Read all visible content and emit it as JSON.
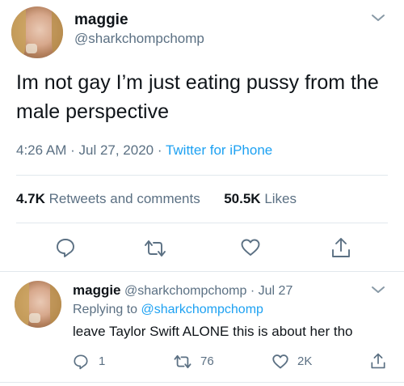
{
  "tweet": {
    "author_name": "maggie",
    "author_handle": "@sharkchompchomp",
    "text": "Im not gay I’m just eating pussy from the male perspective",
    "time": "4:26 AM",
    "date": "Jul 27, 2020",
    "source": "Twitter for iPhone",
    "retweets_count": "4.7K",
    "retweets_label": "Retweets and comments",
    "likes_count": "50.5K",
    "likes_label": "Likes"
  },
  "reply": {
    "author_name": "maggie",
    "author_handle": "@sharkchompchomp",
    "date": "Jul 27",
    "replying_to_prefix": "Replying to",
    "replying_to_handle": "@sharkchompchomp",
    "text": "leave Taylor Swift ALONE this is about her tho",
    "reply_count": "1",
    "retweet_count": "76",
    "like_count": "2K"
  },
  "icons": [
    "chevron-down-icon",
    "reply-icon",
    "retweet-icon",
    "like-icon",
    "share-icon"
  ],
  "colors": {
    "link": "#1da1f2",
    "secondary_text": "#5b7083",
    "divider": "#e1e8ed"
  }
}
